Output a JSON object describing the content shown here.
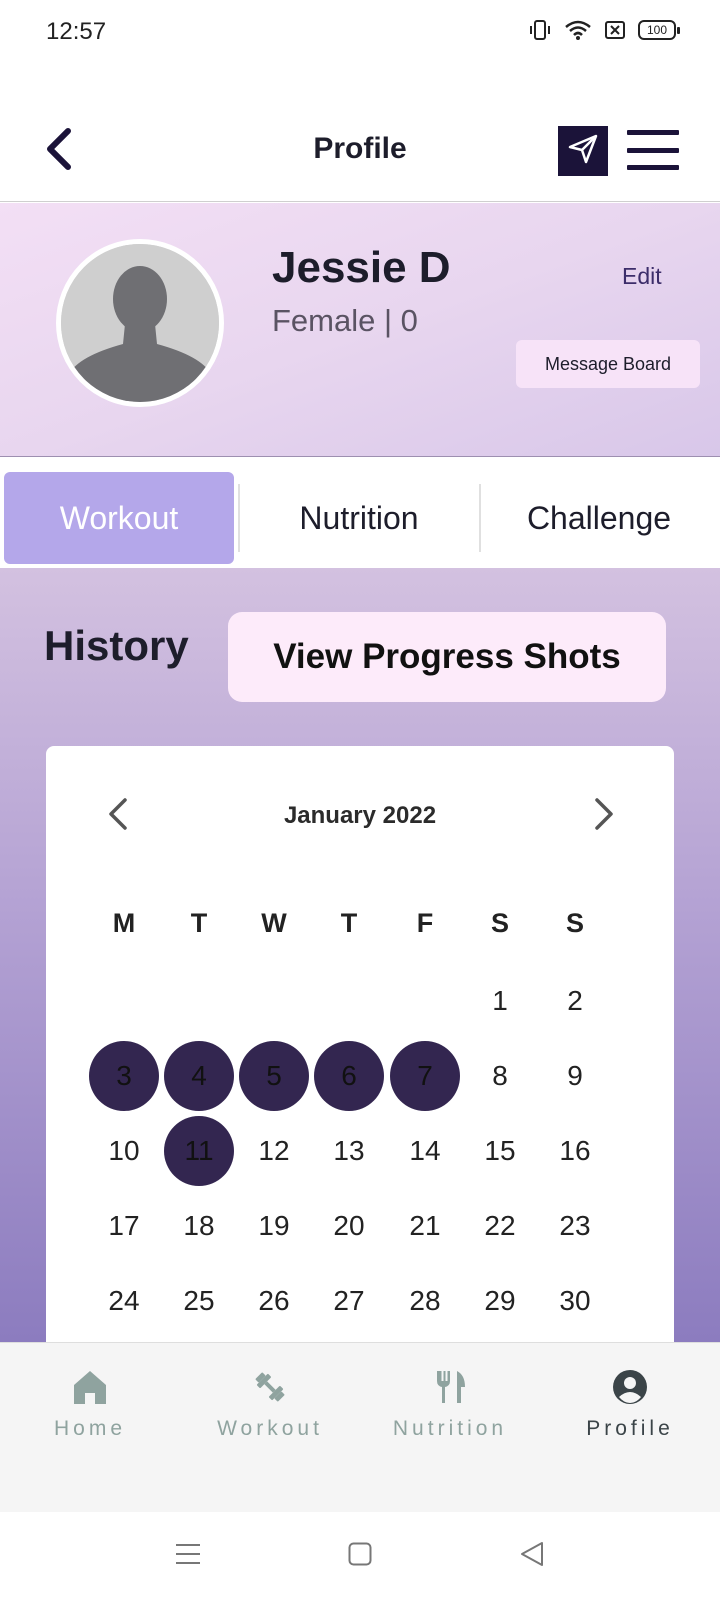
{
  "status_bar": {
    "time": "12:57",
    "battery": "100",
    "icons": [
      "vibrate-icon",
      "wifi-icon",
      "sim-off-icon",
      "battery-icon"
    ]
  },
  "header": {
    "title": "Profile",
    "back_icon": "chevron-left-icon",
    "send_icon": "send-icon",
    "menu_icon": "hamburger-menu-icon"
  },
  "profile": {
    "name": "Jessie D",
    "meta": "Female | 0",
    "edit_label": "Edit",
    "message_board_label": "Message Board",
    "avatar_icon": "default-avatar-icon"
  },
  "tabs": [
    {
      "label": "Workout",
      "active": true
    },
    {
      "label": "Nutrition",
      "active": false
    },
    {
      "label": "Challenge",
      "active": false
    }
  ],
  "history": {
    "title": "History",
    "progress_button_label": "View Progress Shots"
  },
  "calendar": {
    "month_label": "January 2022",
    "weekdays": [
      "M",
      "T",
      "W",
      "T",
      "F",
      "S",
      "S"
    ],
    "rows": [
      [
        "",
        "",
        "",
        "",
        "",
        "1",
        "2"
      ],
      [
        "3",
        "4",
        "5",
        "6",
        "7",
        "8",
        "9"
      ],
      [
        "10",
        "11",
        "12",
        "13",
        "14",
        "15",
        "16"
      ],
      [
        "17",
        "18",
        "19",
        "20",
        "21",
        "22",
        "23"
      ],
      [
        "24",
        "25",
        "26",
        "27",
        "28",
        "29",
        "30"
      ]
    ],
    "marked_days": [
      "3",
      "4",
      "5",
      "6",
      "7",
      "11"
    ]
  },
  "bottom_nav": [
    {
      "label": "Home",
      "icon": "home-icon",
      "active": false
    },
    {
      "label": "Workout",
      "icon": "dumbbell-icon",
      "active": false
    },
    {
      "label": "Nutrition",
      "icon": "fork-knife-icon",
      "active": false
    },
    {
      "label": "Profile",
      "icon": "account-circle-icon",
      "active": true
    }
  ],
  "colors": {
    "brand_dark": "#1b1339",
    "active_tab": "#b4a7ea",
    "marked_day": "#332650",
    "nav_inactive": "#8fa39f",
    "nav_active": "#3b4448"
  }
}
